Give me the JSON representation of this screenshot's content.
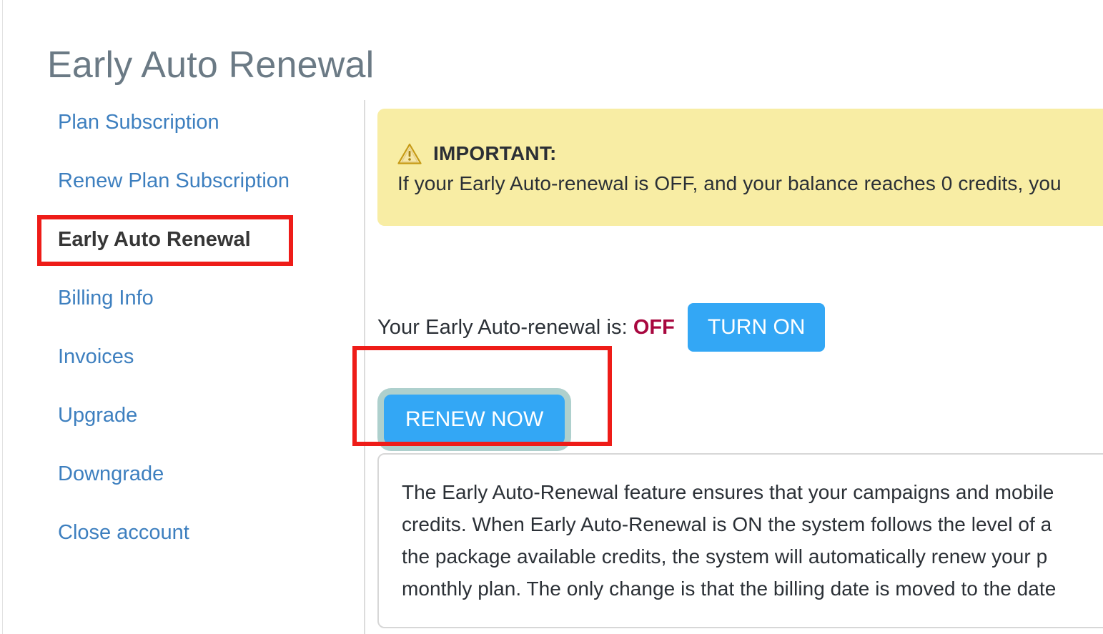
{
  "page": {
    "title": "Early Auto Renewal"
  },
  "sidebar": {
    "items": [
      {
        "label": "Plan Subscription",
        "active": false
      },
      {
        "label": "Renew Plan Subscription",
        "active": false
      },
      {
        "label": "Early Auto Renewal",
        "active": true
      },
      {
        "label": "Billing Info",
        "active": false
      },
      {
        "label": "Invoices",
        "active": false
      },
      {
        "label": "Upgrade",
        "active": false
      },
      {
        "label": "Downgrade",
        "active": false
      },
      {
        "label": "Close account",
        "active": false
      }
    ]
  },
  "notice": {
    "icon": "warning-triangle-icon",
    "title": "IMPORTANT:",
    "body": "If your Early Auto-renewal is OFF, and your balance reaches 0 credits, you",
    "background_color": "#F8EDA4"
  },
  "status": {
    "label": "Your Early Auto-renewal is:",
    "value": "OFF",
    "value_color": "#A8073F"
  },
  "buttons": {
    "turn_on": "TURN ON",
    "renew_now": "RENEW NOW",
    "accent_color": "#33A7F5",
    "focus_ring_color": "#AED0CD"
  },
  "description": {
    "lines": [
      "The Early Auto-Renewal feature ensures that your campaigns and mobile",
      "credits. When Early Auto-Renewal is ON the system follows the level of a",
      "the package available credits, the system will automatically renew your p",
      "monthly plan. The only change is that the billing date is moved to the date"
    ]
  },
  "annotations": {
    "highlight_color": "#EE1C18",
    "boxes": [
      {
        "name": "sidebar-early-auto-renewal-highlight"
      },
      {
        "name": "renew-now-highlight"
      }
    ]
  }
}
